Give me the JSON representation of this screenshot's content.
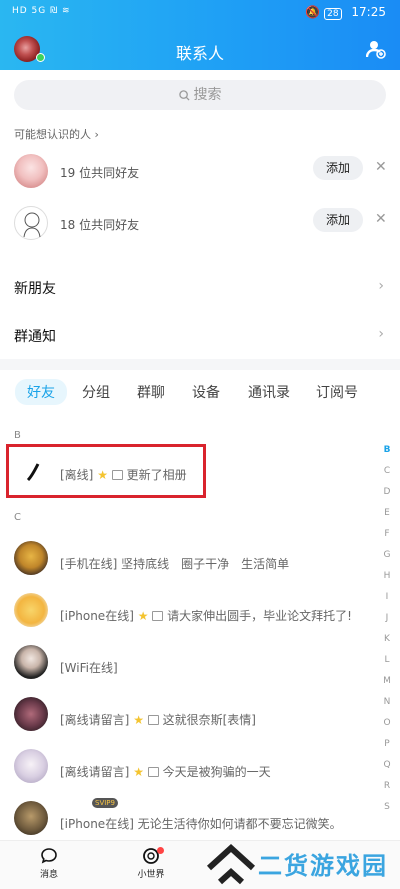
{
  "status_bar": {
    "left": "HD 5G  ₪  ≋",
    "battery": "28",
    "time": "17:25"
  },
  "header": {
    "title": "联系人"
  },
  "search": {
    "placeholder": "搜索"
  },
  "suggestions": {
    "label": "可能想认识的人 ›",
    "items": [
      {
        "mutual": "19 位共同好友",
        "button": "添加"
      },
      {
        "mutual": "18 位共同好友",
        "button": "添加"
      }
    ]
  },
  "rows": {
    "new_friends": "新朋友",
    "group_notify": "群通知"
  },
  "tabs": [
    "好友",
    "分组",
    "群聊",
    "设备",
    "通讯录",
    "订阅号"
  ],
  "friends": {
    "section_b": "B",
    "section_c": "C",
    "b_items": [
      {
        "status": "[离线]",
        "text": "更新了相册"
      }
    ],
    "c_items": [
      {
        "status": "[手机在线] 坚持底线　圈子干净　生活简单",
        "text": ""
      },
      {
        "status": "[iPhone在线]",
        "text": "请大家伸出圆手，毕业论文拜托了!"
      },
      {
        "status": "[WiFi在线]",
        "text": ""
      },
      {
        "status": "[离线请留言]",
        "text": "这就很奈斯[表情]"
      },
      {
        "status": "[离线请留言]",
        "text": "今天是被狗骗的一天"
      },
      {
        "status": "[iPhone在线] 无论生活待你如何请都不要忘记微笑。",
        "text": ""
      }
    ],
    "vip_badge": "SVIP9"
  },
  "index_letters": [
    "B",
    "C",
    "D",
    "E",
    "F",
    "G",
    "H",
    "I",
    "J",
    "K",
    "L",
    "M",
    "N",
    "O",
    "P",
    "Q",
    "R",
    "S",
    "T",
    "U",
    "V",
    "W",
    "X",
    "Y",
    "Z",
    "#"
  ],
  "bottom_nav": {
    "messages": "消息",
    "world": "小世界"
  },
  "watermark": {
    "text": "二货游戏园"
  },
  "colors": {
    "brand_blue": "#1fa0f5",
    "highlight_red": "#d9232d",
    "online_green": "#3fd25c"
  }
}
